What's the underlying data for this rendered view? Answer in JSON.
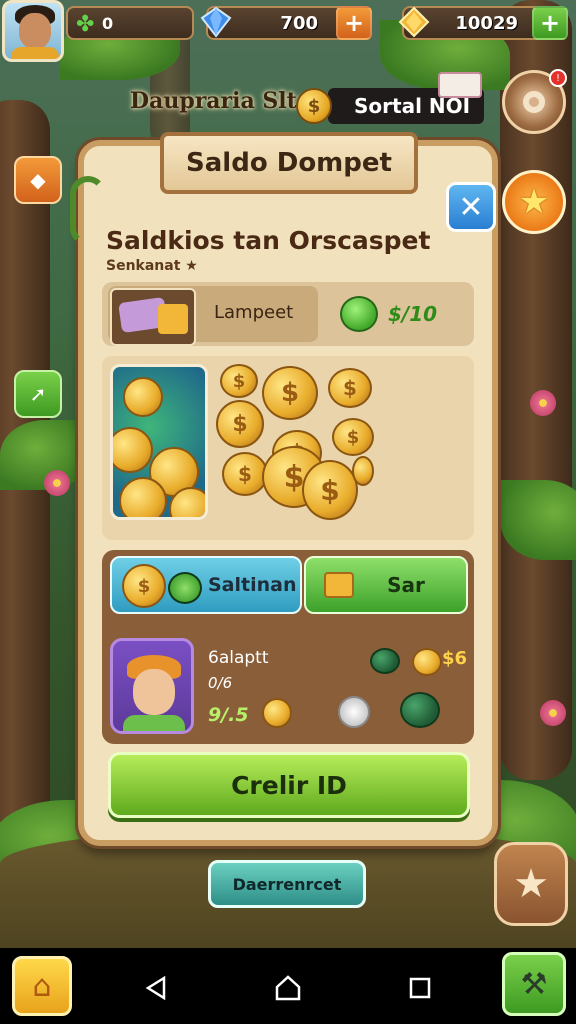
{
  "hud": {
    "clover_value": "0",
    "gems_value": "700",
    "coins_value": "10029"
  },
  "top": {
    "shop_title": "Daupraria Slta",
    "coin_symbol": "$",
    "badge_text": "Sortal NOI"
  },
  "panel": {
    "title": "Saldo Dompet",
    "heading": "Saldkios tan Orscaspet",
    "subheading": "Senkanat ★",
    "wallet_label": "Lampeet",
    "balance": "$/10"
  },
  "actions": {
    "teal_label": "Saltinan",
    "green_label": "Sar"
  },
  "player": {
    "name": "6alaptt",
    "level": "0/6",
    "score": "9/.5",
    "reward": "$6"
  },
  "buttons": {
    "create": "Crelir ID",
    "secondary": "Daerrenrcet"
  },
  "colors": {
    "panel_bg": "#f1e1bd",
    "panel_border": "#c99c62",
    "primary_green": "#5faa1e",
    "accent_orange": "#ea7a18"
  }
}
